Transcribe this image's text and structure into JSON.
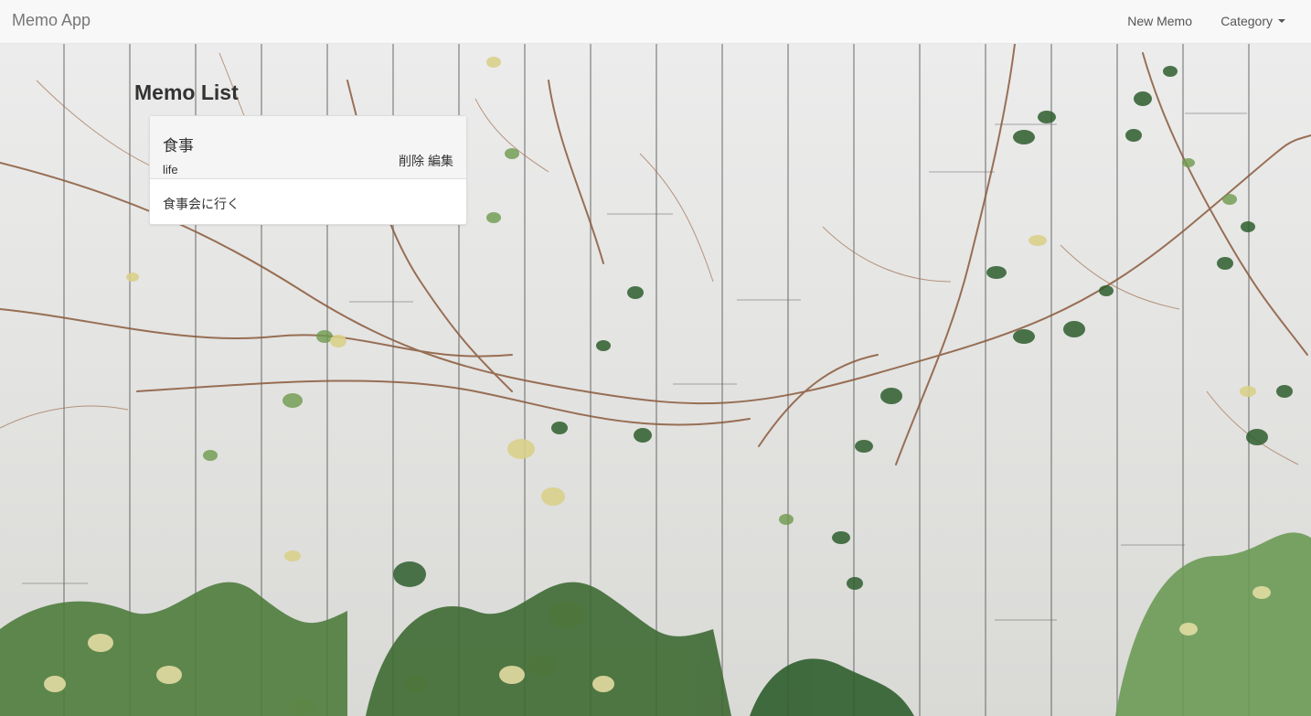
{
  "navbar": {
    "brand": "Memo App",
    "new_memo_label": "New Memo",
    "category_label": "Category"
  },
  "main": {
    "title": "Memo List",
    "memos": [
      {
        "title": "食事",
        "category": "life",
        "delete_label": "削除",
        "edit_label": "編集",
        "body": "食事会に行く"
      }
    ]
  },
  "icons": {
    "category_dropdown": "caret-down-icon"
  },
  "colors": {
    "navbar_bg": "#f8f8f8",
    "panel_heading_bg": "#f5f5f5",
    "wall": "#e4e4e2",
    "leaf_dark": "#2f5e2e",
    "leaf_light": "#d8d08a",
    "vine": "#8a5a3c"
  }
}
